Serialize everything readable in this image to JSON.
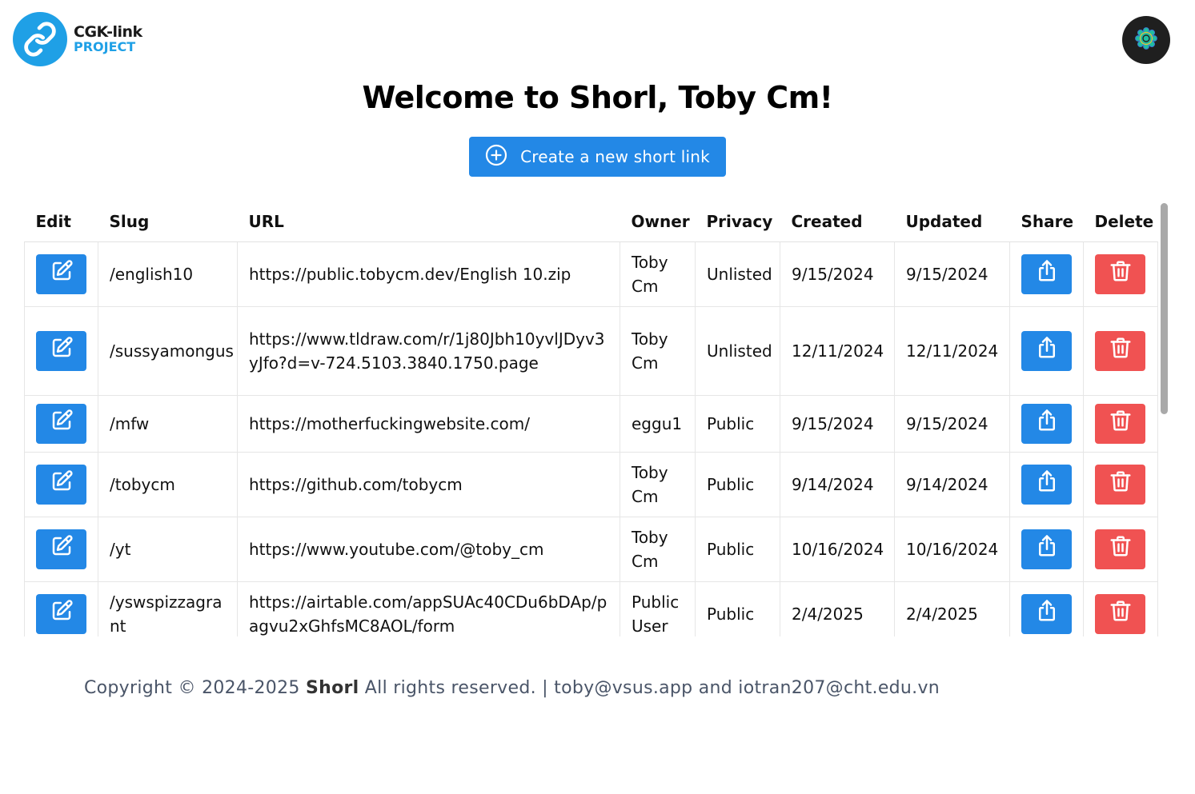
{
  "header": {
    "logo_line1": "CGK-link",
    "logo_line2": "PROJECT",
    "logo_icon": "link-icon",
    "settings_icon": "flower-gear-icon"
  },
  "main": {
    "welcome": "Welcome to Shorl, Toby Cm!",
    "create_label": "Create a new short link",
    "create_icon": "plus-circle-icon"
  },
  "table": {
    "columns": [
      "Edit",
      "Slug",
      "URL",
      "Owner",
      "Privacy",
      "Created",
      "Updated",
      "Share",
      "Delete"
    ],
    "rows": [
      {
        "slug": "/english10",
        "url": "https://public.tobycm.dev/English 10.zip",
        "owner": "Toby Cm",
        "privacy": "Unlisted",
        "created": "9/15/2024",
        "updated": "9/15/2024"
      },
      {
        "slug": "/sussyamongus",
        "url": "https://www.tldraw.com/r/1j80Jbh10yvlJDyv3yJfo?d=v-724.5103.3840.1750.page",
        "owner": "Toby Cm",
        "privacy": "Unlisted",
        "created": "12/11/2024",
        "updated": "12/11/2024"
      },
      {
        "slug": "/mfw",
        "url": "https://motherfuckingwebsite.com/",
        "owner": "eggu1",
        "privacy": "Public",
        "created": "9/15/2024",
        "updated": "9/15/2024"
      },
      {
        "slug": "/tobycm",
        "url": "https://github.com/tobycm",
        "owner": "Toby Cm",
        "privacy": "Public",
        "created": "9/14/2024",
        "updated": "9/14/2024"
      },
      {
        "slug": "/yt",
        "url": "https://www.youtube.com/@toby_cm",
        "owner": "Toby Cm",
        "privacy": "Public",
        "created": "10/16/2024",
        "updated": "10/16/2024"
      },
      {
        "slug": "/yswspizzagrant",
        "url": "https://airtable.com/appSUAc40CDu6bDAp/pagvu2xGhfsMC8AOL/form",
        "owner": "Public User",
        "privacy": "Public",
        "created": "2/4/2025",
        "updated": "2/4/2025"
      }
    ],
    "edit_icon": "edit-icon",
    "share_icon": "share-icon",
    "delete_icon": "trash-icon"
  },
  "footer": {
    "prefix": "Copyright © 2024-2025 ",
    "brand": "Shorl",
    "suffix": " All rights reserved. | toby@vsus.app and iotran207@cht.edu.vn"
  },
  "colors": {
    "primary": "#2388e6",
    "danger": "#f05252",
    "logo_blue": "#1fa0e6"
  }
}
